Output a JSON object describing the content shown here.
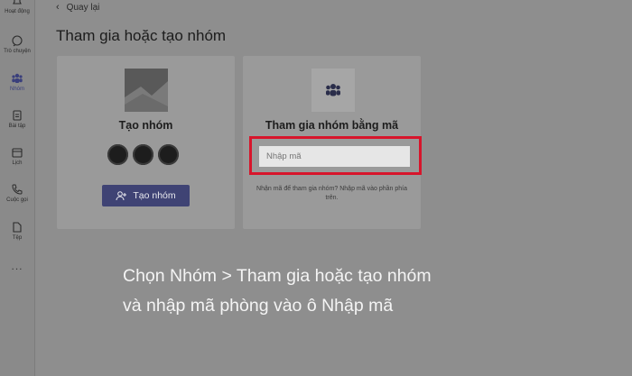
{
  "sidebar": {
    "items": [
      {
        "label": "Hoạt động",
        "icon": "bell-icon"
      },
      {
        "label": "Trò chuyện",
        "icon": "chat-icon"
      },
      {
        "label": "Nhóm",
        "icon": "teams-icon"
      },
      {
        "label": "Bài tập",
        "icon": "assignment-icon"
      },
      {
        "label": "Lịch",
        "icon": "calendar-icon"
      },
      {
        "label": "Cuộc gọi",
        "icon": "phone-icon"
      },
      {
        "label": "Tệp",
        "icon": "file-icon"
      }
    ],
    "more": "..."
  },
  "header": {
    "back_label": "Quay lại",
    "title": "Tham gia hoặc tạo nhóm"
  },
  "create_card": {
    "title": "Tạo nhóm",
    "button_label": "Tạo nhóm"
  },
  "join_card": {
    "title": "Tham gia nhóm bằng mã",
    "input_placeholder": "Nhập mã",
    "help_text": "Nhận mã để tham gia nhóm? Nhập mã vào phần phía trên."
  },
  "caption": {
    "line1": "Chọn Nhóm > Tham gia hoặc tạo nhóm",
    "line2": "và nhập mã phòng vào ô Nhập mã"
  },
  "colors": {
    "highlight_border": "#d7152b",
    "primary_button": "#3f4374",
    "overlay_background": "#8e8e8e"
  }
}
